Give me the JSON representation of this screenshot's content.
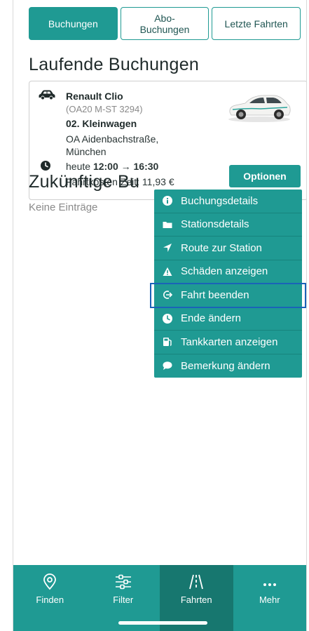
{
  "tabs": [
    {
      "label": "Buchungen",
      "active": true
    },
    {
      "label": "Abo-\nBuchungen",
      "active": false
    },
    {
      "label": "Letzte Fahrten",
      "active": false
    }
  ],
  "current": {
    "title": "Laufende Buchungen",
    "booking": {
      "car_name": "Renault Clio",
      "plate": "(OA20 M-ST 3294)",
      "car_class": "02. Kleinwagen",
      "station": "OA Aidenbachstraße, München",
      "time_prefix": "heute ",
      "time_range": "12:00 → 16:30",
      "cost": "Fahrtkosten Zeit: 11,93 €"
    },
    "options_label": "Optionen"
  },
  "options_menu": [
    {
      "icon": "info-icon",
      "label": "Buchungsdetails"
    },
    {
      "icon": "folder-icon",
      "label": "Stationsdetails"
    },
    {
      "icon": "location-arrow-icon",
      "label": "Route zur Station"
    },
    {
      "icon": "warning-icon",
      "label": "Schäden anzeigen"
    },
    {
      "icon": "sign-out-icon",
      "label": "Fahrt beenden",
      "highlighted": true
    },
    {
      "icon": "clock-icon",
      "label": "Ende ändern"
    },
    {
      "icon": "fuel-card-icon",
      "label": "Tankkarten anzeigen"
    },
    {
      "icon": "comment-icon",
      "label": "Bemerkung ändern"
    }
  ],
  "future": {
    "title": "Zukünftige Bu",
    "empty_text": "Keine Einträge"
  },
  "bottom_nav": [
    {
      "icon": "map-pin-icon",
      "label": "Finden",
      "active": false
    },
    {
      "icon": "filter-sliders-icon",
      "label": "Filter",
      "active": false
    },
    {
      "icon": "road-icon",
      "label": "Fahrten",
      "active": true
    },
    {
      "icon": "more-dots-icon",
      "label": "Mehr",
      "active": false
    }
  ],
  "colors": {
    "accent": "#1f9a93",
    "accent_dark": "#17776f",
    "highlight_outline": "#1a63b8"
  }
}
